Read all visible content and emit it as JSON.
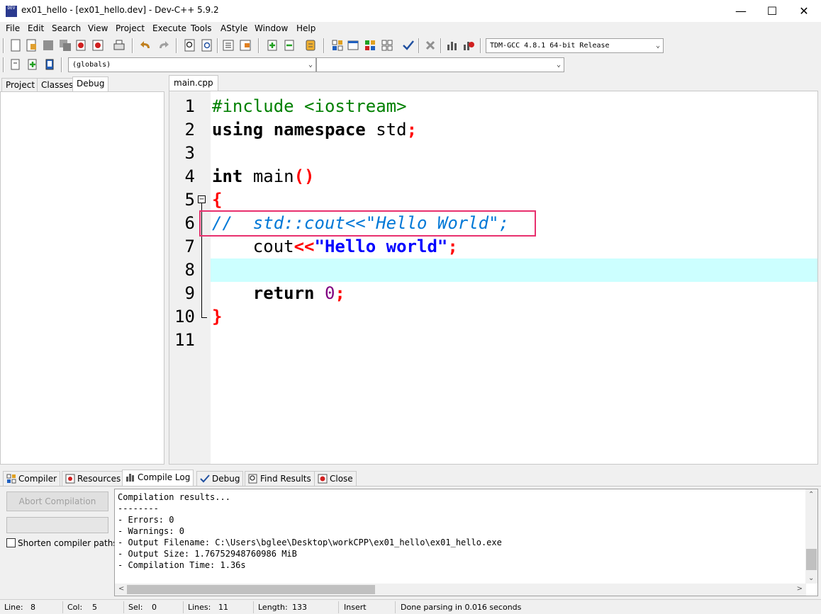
{
  "window": {
    "title": "ex01_hello - [ex01_hello.dev] - Dev-C++ 5.9.2",
    "icon_label": "DEV",
    "minimize": "—",
    "maximize": "☐",
    "close": "✕"
  },
  "menu": [
    "File",
    "Edit",
    "Search",
    "View",
    "Project",
    "Execute",
    "Tools",
    "AStyle",
    "Window",
    "Help"
  ],
  "toolbar": {
    "compiler_select": "TDM-GCC 4.8.1 64-bit Release",
    "scope_select": "(globals)",
    "member_select": ""
  },
  "left_tabs": [
    "Project",
    "Classes",
    "Debug"
  ],
  "editor": {
    "tab": "main.cpp",
    "line_numbers": [
      "1",
      "2",
      "3",
      "4",
      "5",
      "6",
      "7",
      "8",
      "9",
      "10",
      "11"
    ],
    "lines": {
      "l1": "#include <iostream>",
      "l2_kw1": "using",
      "l2_kw2": "namespace",
      "l2_id": "std",
      "l2_semi": ";",
      "l4_kw": "int",
      "l4_id": "main",
      "l4_paren": "()",
      "l5_brace": "{",
      "l6_comment": "//  std::cout<<\"Hello World\";",
      "l7_id": "cout",
      "l7_op": "<<",
      "l7_str": "\"Hello world\"",
      "l7_semi": ";",
      "l9_kw": "return",
      "l9_num": "0",
      "l9_semi": ";",
      "l10_brace": "}"
    },
    "fold_symbol": "−"
  },
  "bottom_tabs": [
    "Compiler",
    "Resources",
    "Compile Log",
    "Debug",
    "Find Results",
    "Close"
  ],
  "compile_panel": {
    "abort_button": "Abort Compilation",
    "shorten_label": "Shorten compiler paths",
    "log": "Compilation results...\n--------\n- Errors: 0\n- Warnings: 0\n- Output Filename: C:\\Users\\bglee\\Desktop\\workCPP\\ex01_hello\\ex01_hello.exe\n- Output Size: 1.76752948760986 MiB\n- Compilation Time: 1.36s"
  },
  "status": {
    "line_label": "Line:",
    "line_val": "8",
    "col_label": "Col:",
    "col_val": "5",
    "sel_label": "Sel:",
    "sel_val": "0",
    "lines_label": "Lines:",
    "lines_val": "11",
    "length_label": "Length:",
    "length_val": "133",
    "mode": "Insert",
    "message": "Done parsing in 0.016 seconds"
  }
}
